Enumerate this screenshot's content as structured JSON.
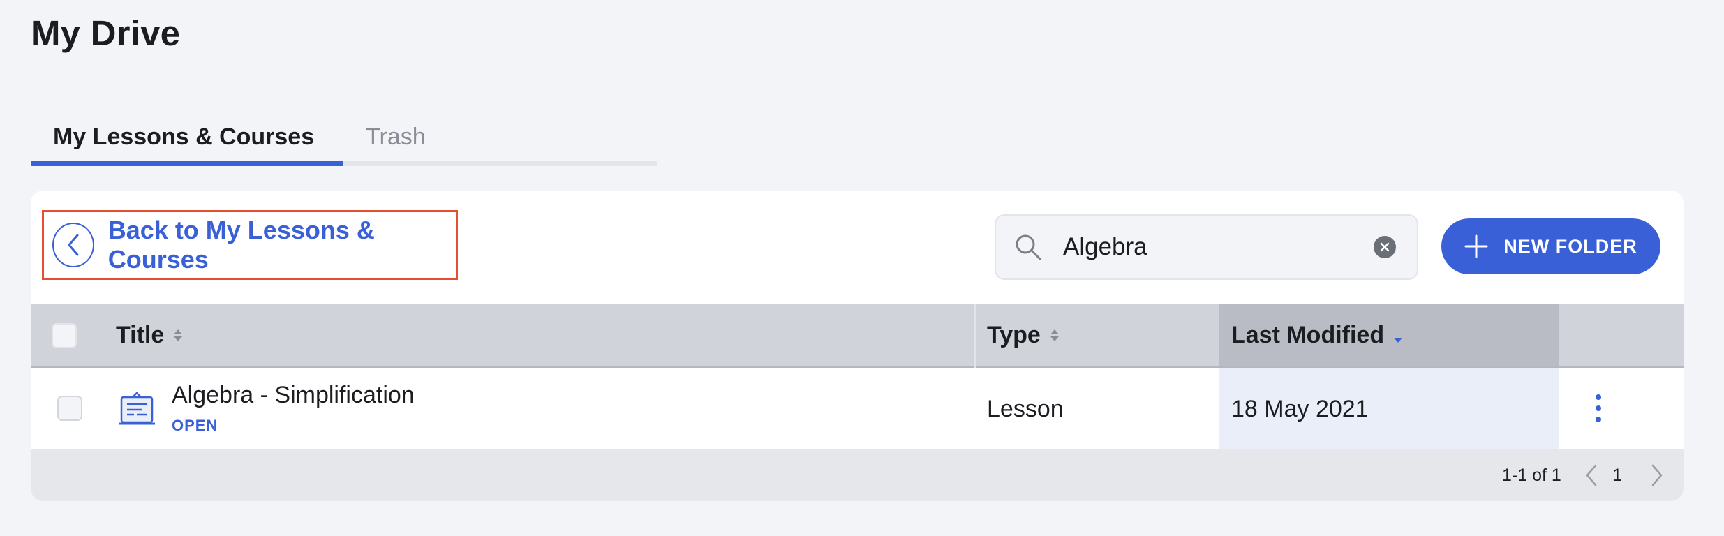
{
  "page": {
    "title": "My Drive"
  },
  "tabs": [
    {
      "label": "My Lessons & Courses",
      "active": true
    },
    {
      "label": "Trash",
      "active": false
    }
  ],
  "toolbar": {
    "back_label": "Back to My Lessons & Courses",
    "search_value": "Algebra",
    "new_folder_label": "NEW FOLDER"
  },
  "table": {
    "columns": [
      "Title",
      "Type",
      "Last Modified"
    ],
    "rows": [
      {
        "title": "Algebra - Simplification",
        "status": "OPEN",
        "type": "Lesson",
        "last_modified": "18 May 2021"
      }
    ]
  },
  "pagination": {
    "summary": "1-1 of 1",
    "current_page": "1"
  },
  "colors": {
    "accent": "#3960d7",
    "highlight_border": "#e2502f",
    "header_bg": "#d0d3d9"
  }
}
